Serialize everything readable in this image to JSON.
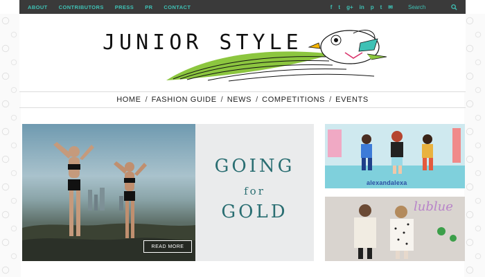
{
  "topbar": {
    "links": [
      "ABOUT",
      "CONTRIBUTORS",
      "PRESS",
      "PR",
      "CONTACT"
    ],
    "social_icons": [
      {
        "name": "facebook-icon",
        "glyph": "f"
      },
      {
        "name": "twitter-icon",
        "glyph": "t"
      },
      {
        "name": "google-plus-icon",
        "glyph": "g+"
      },
      {
        "name": "linkedin-icon",
        "glyph": "in"
      },
      {
        "name": "pinterest-icon",
        "glyph": "p"
      },
      {
        "name": "tumblr-icon",
        "glyph": "t"
      },
      {
        "name": "email-icon",
        "glyph": "✉"
      }
    ],
    "search_placeholder": "Search",
    "accent_color": "#3fc1b5",
    "bar_color": "#3a3a3a"
  },
  "header": {
    "logo_text": "JUNIOR STYLE"
  },
  "nav": {
    "items": [
      "HOME",
      "FASHION GUIDE",
      "NEWS",
      "COMPETITIONS",
      "EVENTS"
    ],
    "separator": "/"
  },
  "hero": {
    "line1": "GOING",
    "line2": "for",
    "line3": "GOLD",
    "read_more": "READ MORE",
    "text_color": "#2a6e72"
  },
  "tiles": [
    {
      "brand": "alexandalexa"
    },
    {
      "brand": "lublue"
    }
  ]
}
